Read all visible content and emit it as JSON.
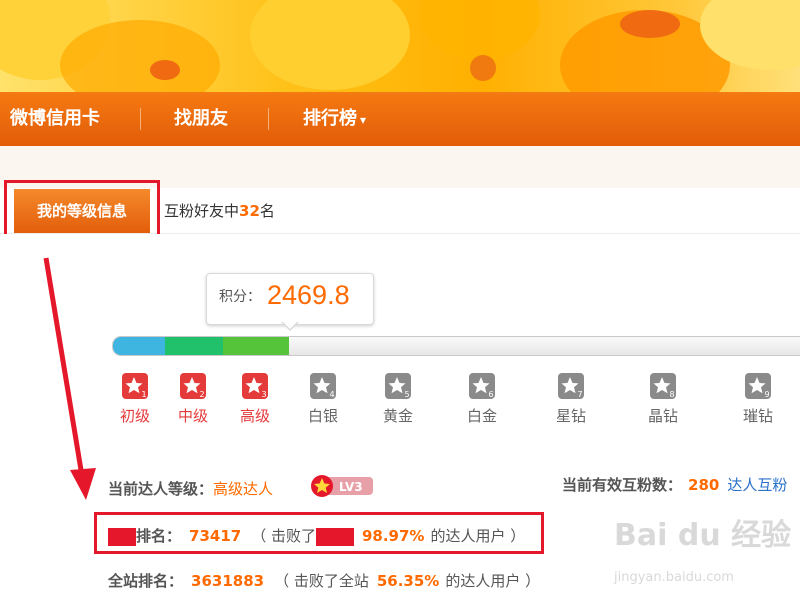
{
  "nav": {
    "items": [
      {
        "label": "微博信用卡"
      },
      {
        "label": "找朋友"
      },
      {
        "label": "排行榜",
        "caret": "▾"
      }
    ]
  },
  "tabs": {
    "active_label": "我的等级信息",
    "other_prefix": "互粉好友中",
    "other_num": "32",
    "other_suffix": "名"
  },
  "score": {
    "label": "积分：",
    "value": "2469.8"
  },
  "progress": {
    "filled_segments": 3,
    "segment_colors": [
      "#3eb4e0",
      "#21c16c",
      "#56c43b"
    ]
  },
  "levels": [
    {
      "label": "初级",
      "active": true,
      "num": "1"
    },
    {
      "label": "中级",
      "active": true,
      "num": "2"
    },
    {
      "label": "高级",
      "active": true,
      "num": "3"
    },
    {
      "label": "白银",
      "active": false,
      "num": "4"
    },
    {
      "label": "黄金",
      "active": false,
      "num": "5"
    },
    {
      "label": "白金",
      "active": false,
      "num": "6"
    },
    {
      "label": "星钻",
      "active": false,
      "num": "7"
    },
    {
      "label": "晶钻",
      "active": false,
      "num": "8"
    },
    {
      "label": "璀钻",
      "active": false,
      "num": "9"
    }
  ],
  "info": {
    "current_level_label": "当前达人等级：",
    "current_level_value": "高级达人",
    "badge_text": "LV3",
    "mutual_label": "当前有效互粉数：",
    "mutual_value": "280",
    "mutual_link": "达人互粉",
    "rank1_label": "排名：",
    "rank1_value": "73417",
    "rank1_open": "（ 击败了",
    "rank1_percent": "98.97%",
    "rank1_close": "的达人用户 ）",
    "rank2_label": "全站排名：",
    "rank2_value": "3631883",
    "rank2_open": "（ 击败了全站",
    "rank2_percent": "56.35%",
    "rank2_close": "的达人用户 ）"
  },
  "watermark": {
    "logo": "Bai du 经验",
    "url": "jingyan.baidu.com"
  },
  "colors": {
    "nav_orange": "#e8650a",
    "accent_orange": "#ff6a00",
    "highlight_red": "#e5172a",
    "active_level_red": "#e53a3a",
    "inactive_level_gray": "#8a8a8a"
  }
}
